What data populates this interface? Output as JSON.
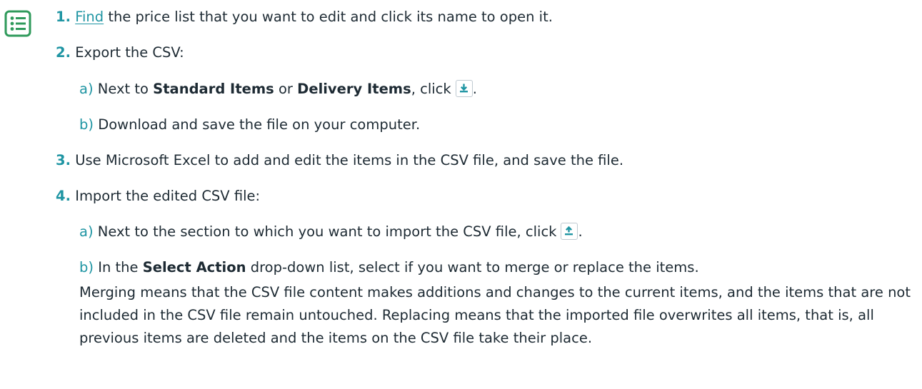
{
  "steps": [
    {
      "num": "1.",
      "link": "Find",
      "rest": " the price list that you want to edit and click its name to open it."
    },
    {
      "num": "2.",
      "text": "Export the CSV:"
    },
    {
      "num": "3.",
      "text": "Use Microsoft Excel to add and edit the items in the CSV file, and save the file."
    },
    {
      "num": "4.",
      "text": "Import the edited CSV file:"
    }
  ],
  "substeps": {
    "s2a": {
      "label": "a)",
      "pre": "Next to ",
      "b1": "Standard Items",
      "mid": " or ",
      "b2": "Delivery Items",
      "post": ", click",
      "end": "."
    },
    "s2b": {
      "label": "b)",
      "text": "Download and save the file on your computer."
    },
    "s4a": {
      "label": "a)",
      "text": "Next to the section to which you want to import the CSV file, click",
      "end": "."
    },
    "s4b": {
      "label": "b)",
      "pre": "In the ",
      "b1": "Select Action",
      "post": " drop-down list, select if you want to merge or replace the items."
    }
  },
  "note": "Merging means that the CSV file content makes additions and changes to the current items, and the items that are not included in the CSV file remain untouched. Replacing means that the imported file overwrites all items, that is, all previous items are deleted and the items on the CSV file take their place.",
  "icons": {
    "steps": "numbered-list-icon",
    "export": "download-icon",
    "import": "upload-icon"
  },
  "colors": {
    "accent": "#1f95a3",
    "icon_green": "#2f9a5b",
    "text": "#1d2a33"
  }
}
